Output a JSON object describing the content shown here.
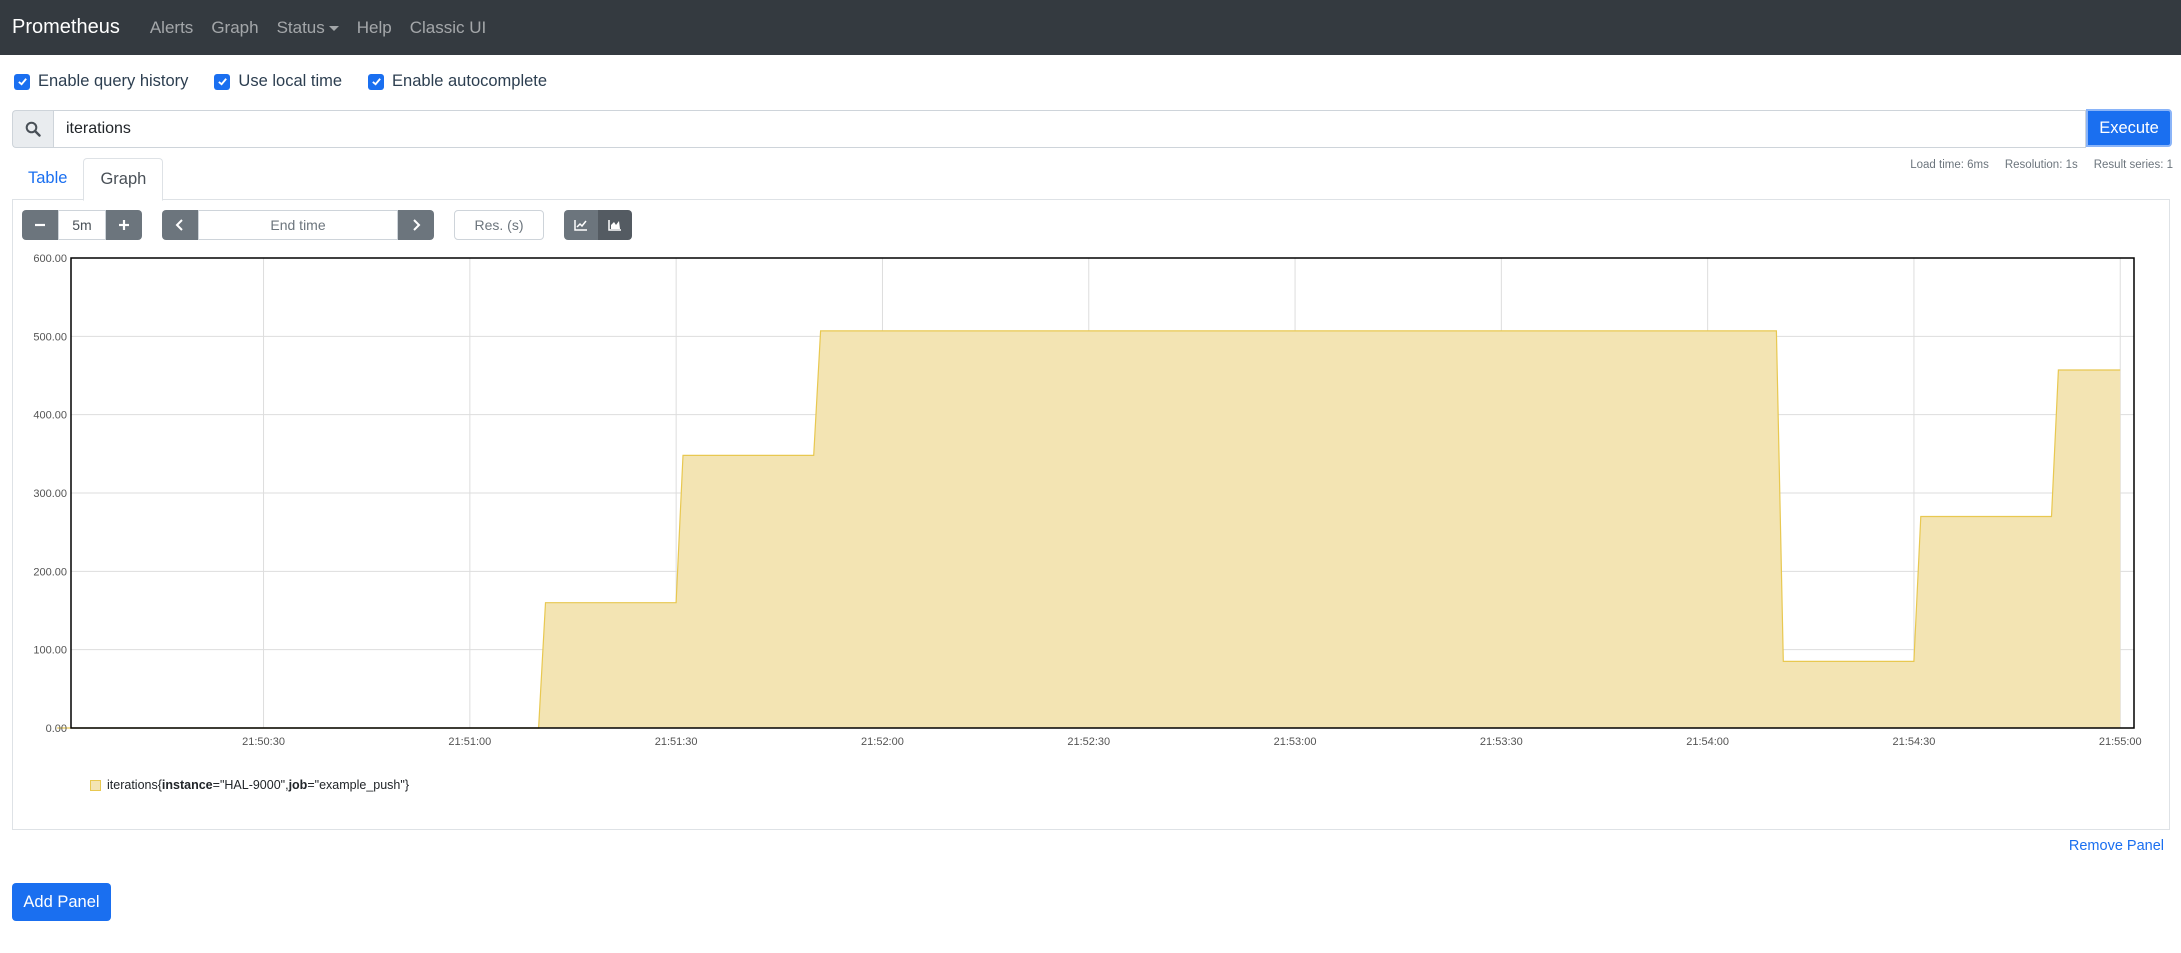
{
  "navbar": {
    "brand": "Prometheus",
    "links": [
      "Alerts",
      "Graph",
      "Status",
      "Help",
      "Classic UI"
    ]
  },
  "options": {
    "query_history": "Enable query history",
    "local_time": "Use local time",
    "autocomplete": "Enable autocomplete"
  },
  "query": {
    "value": "iterations",
    "execute_label": "Execute"
  },
  "tabs": {
    "table": "Table",
    "graph": "Graph"
  },
  "stats": {
    "load_time": "Load time: 6ms",
    "resolution": "Resolution: 1s",
    "result_series": "Result series: 1"
  },
  "controls": {
    "range": "5m",
    "end_time_placeholder": "End time",
    "res_placeholder": "Res. (s)",
    "stacked": true
  },
  "legend": {
    "metric": "iterations",
    "open": "{",
    "label1_key": "instance",
    "label1_val": "=\"HAL-9000\", ",
    "label2_key": "job",
    "label2_val": "=\"example_push\"",
    "close": "}"
  },
  "actions": {
    "remove_panel": "Remove Panel",
    "add_panel": "Add Panel"
  },
  "colors": {
    "accent": "#1a6ff0",
    "series_fill": "#f3e4b3",
    "series_line": "#e8c850",
    "navbar": "#343a40"
  },
  "chart_data": {
    "type": "area",
    "series": [
      {
        "name": "iterations{instance=\"HAL-9000\", job=\"example_push\"}",
        "points": [
          [
            "21:50:00",
            0
          ],
          [
            "21:51:10",
            0
          ],
          [
            "21:51:11",
            160
          ],
          [
            "21:51:30",
            160
          ],
          [
            "21:51:31",
            348
          ],
          [
            "21:51:50",
            348
          ],
          [
            "21:51:51",
            507
          ],
          [
            "21:54:10",
            507
          ],
          [
            "21:54:11",
            85
          ],
          [
            "21:54:30",
            85
          ],
          [
            "21:54:31",
            270
          ],
          [
            "21:54:50",
            270
          ],
          [
            "21:54:51",
            457
          ],
          [
            "21:55:00",
            457
          ]
        ]
      }
    ],
    "yticks": [
      "0.00",
      "100.00",
      "200.00",
      "300.00",
      "400.00",
      "500.00",
      "600.00"
    ],
    "xticks": [
      "21:50:30",
      "21:51:00",
      "21:51:30",
      "21:52:00",
      "21:52:30",
      "21:53:00",
      "21:53:30",
      "21:54:00",
      "21:54:30",
      "21:55:00"
    ],
    "ylim": [
      0,
      600
    ],
    "xlim": [
      "21:50:02",
      "21:55:02"
    ],
    "grid": true
  }
}
